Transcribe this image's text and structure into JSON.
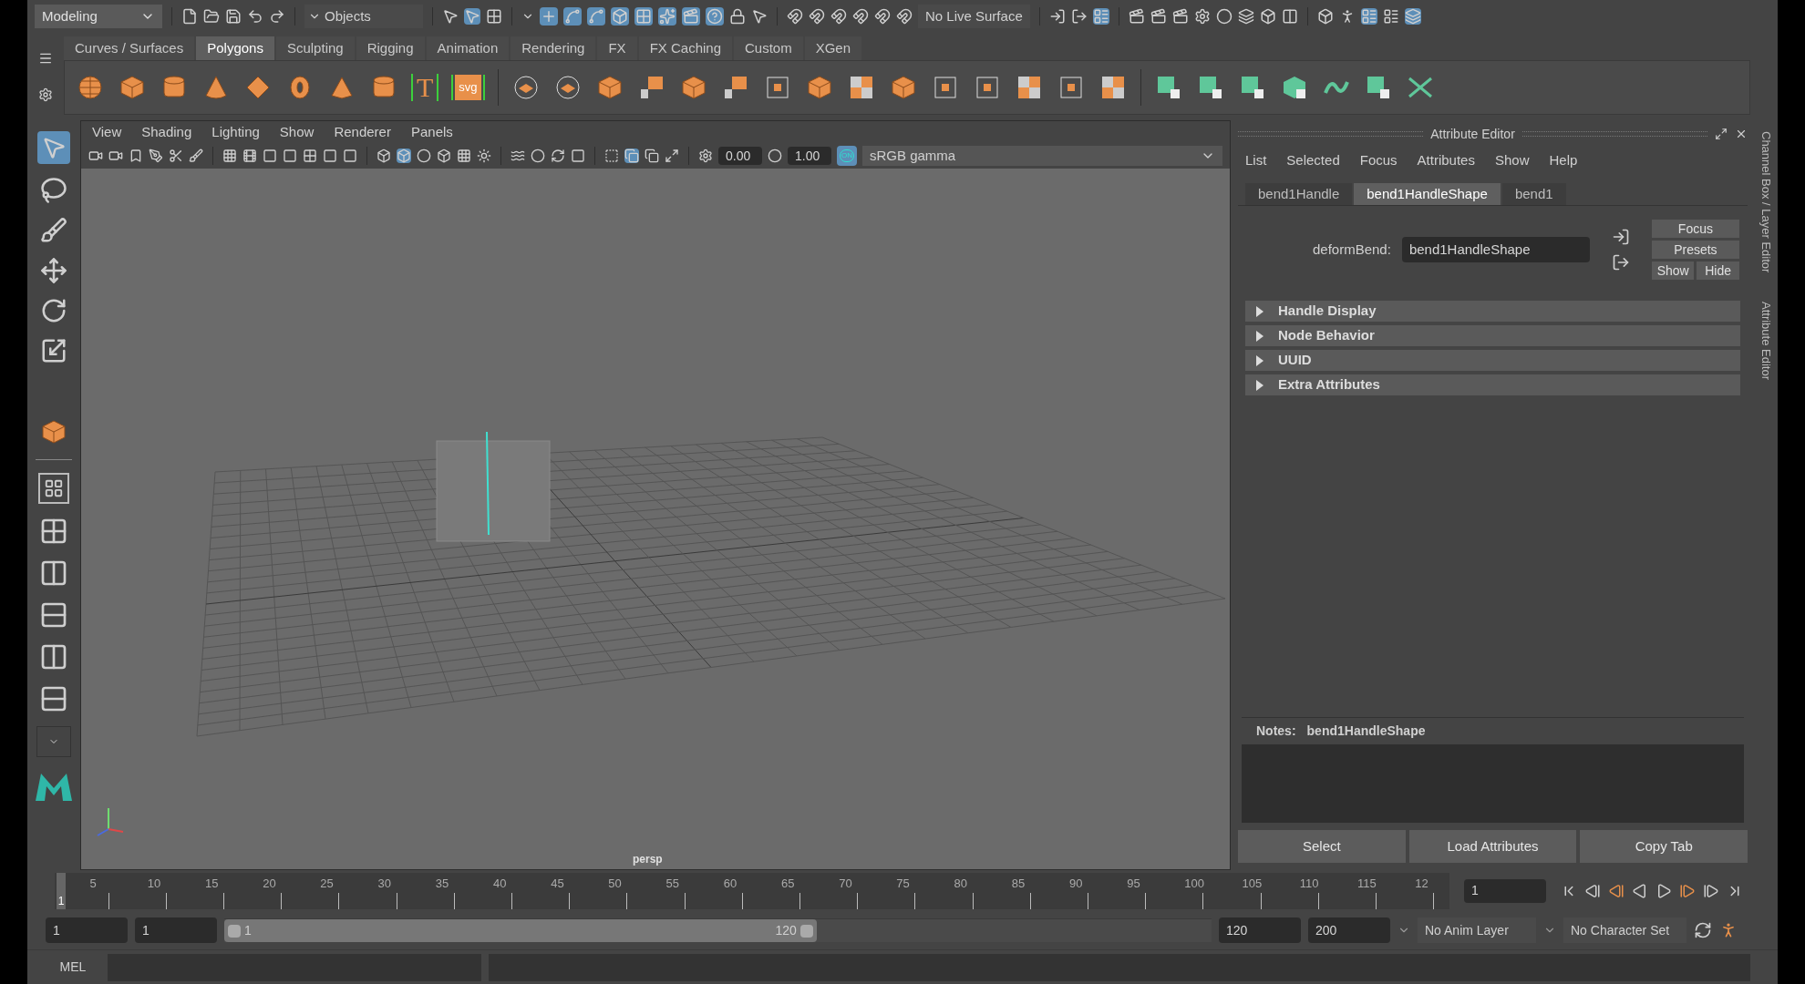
{
  "status_line": {
    "menu_set": "Modeling",
    "selection_mode": "Objects",
    "live_surface": "No Live Surface"
  },
  "shelf": {
    "tabs": [
      {
        "label": "Curves / Surfaces",
        "selected": false
      },
      {
        "label": "Polygons",
        "selected": true
      },
      {
        "label": "Sculpting",
        "selected": false
      },
      {
        "label": "Rigging",
        "selected": false
      },
      {
        "label": "Animation",
        "selected": false
      },
      {
        "label": "Rendering",
        "selected": false
      },
      {
        "label": "FX",
        "selected": false
      },
      {
        "label": "FX Caching",
        "selected": false
      },
      {
        "label": "Custom",
        "selected": false
      },
      {
        "label": "XGen",
        "selected": false
      }
    ],
    "text_tool_letter": "T",
    "svg_tool_label": "svg"
  },
  "viewport": {
    "menus": [
      "View",
      "Shading",
      "Lighting",
      "Show",
      "Renderer",
      "Panels"
    ],
    "exposure": "0.00",
    "gamma": "1.00",
    "color_management": "ON",
    "color_space": "sRGB gamma",
    "camera_label": "persp"
  },
  "attribute_editor": {
    "title": "Attribute Editor",
    "menus": [
      "List",
      "Selected",
      "Focus",
      "Attributes",
      "Show",
      "Help"
    ],
    "tabs": [
      {
        "label": "bend1Handle",
        "selected": false
      },
      {
        "label": "bend1HandleShape",
        "selected": true
      },
      {
        "label": "bend1",
        "selected": false
      }
    ],
    "field_label": "deformBend:",
    "field_value": "bend1HandleShape",
    "side_buttons": [
      "Focus",
      "Presets",
      "Show",
      "Hide"
    ],
    "sections": [
      {
        "label": "Handle Display",
        "expanded": false
      },
      {
        "label": "Node Behavior",
        "expanded": false
      },
      {
        "label": "UUID",
        "expanded": false
      },
      {
        "label": "Extra Attributes",
        "expanded": false
      }
    ],
    "notes_label": "Notes:",
    "notes_node": "bend1HandleShape",
    "footer_buttons": [
      "Select",
      "Load Attributes",
      "Copy Tab"
    ]
  },
  "side_tabs": [
    "Channel Box / Layer Editor",
    "Attribute Editor"
  ],
  "time_slider": {
    "level": 0,
    "current_frame_marker": "1",
    "tick_labels": [
      "5",
      "10",
      "15",
      "20",
      "25",
      "30",
      "35",
      "40",
      "45",
      "50",
      "55",
      "60",
      "65",
      "70",
      "75",
      "80",
      "85",
      "90",
      "95",
      "100",
      "105",
      "110",
      "115",
      "12"
    ],
    "current_frame": "1"
  },
  "range_slider": {
    "level": 0.6,
    "start": "1",
    "playback_start": "1",
    "range_start": "1",
    "range_end": "120",
    "playback_end": "120",
    "end": "200",
    "anim_layer": "No Anim Layer",
    "character_set": "No Character Set"
  },
  "command_line": {
    "language": "MEL"
  }
}
